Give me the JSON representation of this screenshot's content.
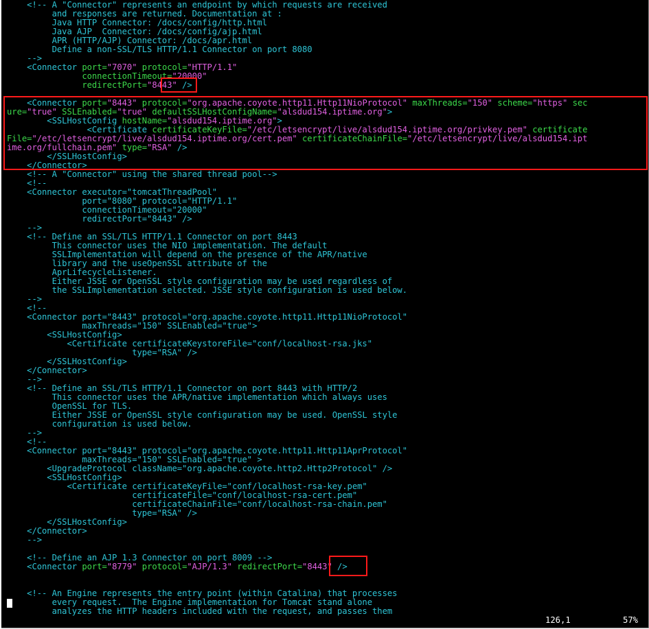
{
  "editor": {
    "lines": [
      [
        [
          "c",
          "    <!-- A \"Connector\" represents an endpoint by which requests are received"
        ]
      ],
      [
        [
          "c",
          "         and responses are returned. Documentation at :"
        ]
      ],
      [
        [
          "c",
          "         Java HTTP Connector: /docs/config/http.html"
        ]
      ],
      [
        [
          "c",
          "         Java AJP  Connector: /docs/config/ajp.html"
        ]
      ],
      [
        [
          "c",
          "         APR (HTTP/AJP) Connector: /docs/apr.html"
        ]
      ],
      [
        [
          "c",
          "         Define a non-SSL/TLS HTTP/1.1 Connector on port 8080"
        ]
      ],
      [
        [
          "c",
          "    -->"
        ]
      ],
      [
        [
          "c",
          "    <Connector "
        ],
        [
          "a",
          "port="
        ],
        [
          "v",
          "\"7070\" "
        ],
        [
          "a",
          "protocol="
        ],
        [
          "v",
          "\"HTTP/1.1\""
        ]
      ],
      [
        [
          "a",
          "               connectionTimeout="
        ],
        [
          "v",
          "\"20000\""
        ]
      ],
      [
        [
          "a",
          "               redirectPort="
        ],
        [
          "v",
          "\"8443\" "
        ],
        [
          "c",
          "/>"
        ]
      ],
      [
        [
          "t",
          ""
        ]
      ],
      [
        [
          "c",
          "    <Connector "
        ],
        [
          "a",
          "port="
        ],
        [
          "v",
          "\"8443\" "
        ],
        [
          "a",
          "protocol="
        ],
        [
          "v",
          "\"org.apache.coyote.http11.Http11NioProtocol\" "
        ],
        [
          "a",
          "maxThreads="
        ],
        [
          "v",
          "\"150\" "
        ],
        [
          "a",
          "scheme="
        ],
        [
          "v",
          "\"https\" "
        ],
        [
          "a",
          "sec"
        ]
      ],
      [
        [
          "a",
          "ure="
        ],
        [
          "v",
          "\"true\" "
        ],
        [
          "a",
          "SSLEnabled="
        ],
        [
          "v",
          "\"true\" "
        ],
        [
          "a",
          "defaultSSLHostConfigName="
        ],
        [
          "v",
          "\"alsdud154.iptime.org\""
        ],
        [
          "c",
          ">"
        ]
      ],
      [
        [
          "c",
          "        <SSLHostConfig "
        ],
        [
          "a",
          "hostName="
        ],
        [
          "v",
          "\"alsdud154.iptime.org\""
        ],
        [
          "c",
          ">"
        ]
      ],
      [
        [
          "c",
          "                <Certificate "
        ],
        [
          "a",
          "certificateKeyFile="
        ],
        [
          "v",
          "\"/etc/letsencrypt/live/alsdud154.iptime.org/privkey.pem\" "
        ],
        [
          "a",
          "certificate"
        ]
      ],
      [
        [
          "a",
          "File="
        ],
        [
          "v",
          "\"/etc/letsencrypt/live/alsdud154.iptime.org/cert.pem\" "
        ],
        [
          "a",
          "certificateChainFile="
        ],
        [
          "v",
          "\"/etc/letsencrypt/live/alsdud154.ipt"
        ]
      ],
      [
        [
          "v",
          "ime.org/fullchain.pem\" "
        ],
        [
          "a",
          "type="
        ],
        [
          "v",
          "\"RSA\" "
        ],
        [
          "c",
          "/>"
        ]
      ],
      [
        [
          "c",
          "        </SSLHostConfig>"
        ]
      ],
      [
        [
          "c",
          "    </Connector>"
        ]
      ],
      [
        [
          "c",
          "    <!-- A \"Connector\" using the shared thread pool-->"
        ]
      ],
      [
        [
          "c",
          "    <!--"
        ]
      ],
      [
        [
          "c",
          "    <Connector executor=\"tomcatThreadPool\""
        ]
      ],
      [
        [
          "c",
          "               port=\"8080\" protocol=\"HTTP/1.1\""
        ]
      ],
      [
        [
          "c",
          "               connectionTimeout=\"20000\""
        ]
      ],
      [
        [
          "c",
          "               redirectPort=\"8443\" />"
        ]
      ],
      [
        [
          "c",
          "    -->"
        ]
      ],
      [
        [
          "c",
          "    <!-- Define an SSL/TLS HTTP/1.1 Connector on port 8443"
        ]
      ],
      [
        [
          "c",
          "         This connector uses the NIO implementation. The default"
        ]
      ],
      [
        [
          "c",
          "         SSLImplementation will depend on the presence of the APR/native"
        ]
      ],
      [
        [
          "c",
          "         library and the useOpenSSL attribute of the"
        ]
      ],
      [
        [
          "c",
          "         AprLifecycleListener."
        ]
      ],
      [
        [
          "c",
          "         Either JSSE or OpenSSL style configuration may be used regardless of"
        ]
      ],
      [
        [
          "c",
          "         the SSLImplementation selected. JSSE style configuration is used below."
        ]
      ],
      [
        [
          "c",
          "    -->"
        ]
      ],
      [
        [
          "c",
          "    <!--"
        ]
      ],
      [
        [
          "c",
          "    <Connector port=\"8443\" protocol=\"org.apache.coyote.http11.Http11NioProtocol\""
        ]
      ],
      [
        [
          "c",
          "               maxThreads=\"150\" SSLEnabled=\"true\">"
        ]
      ],
      [
        [
          "c",
          "        <SSLHostConfig>"
        ]
      ],
      [
        [
          "c",
          "            <Certificate certificateKeystoreFile=\"conf/localhost-rsa.jks\""
        ]
      ],
      [
        [
          "c",
          "                         type=\"RSA\" />"
        ]
      ],
      [
        [
          "c",
          "        </SSLHostConfig>"
        ]
      ],
      [
        [
          "c",
          "    </Connector>"
        ]
      ],
      [
        [
          "c",
          "    -->"
        ]
      ],
      [
        [
          "c",
          "    <!-- Define an SSL/TLS HTTP/1.1 Connector on port 8443 with HTTP/2"
        ]
      ],
      [
        [
          "c",
          "         This connector uses the APR/native implementation which always uses"
        ]
      ],
      [
        [
          "c",
          "         OpenSSL for TLS."
        ]
      ],
      [
        [
          "c",
          "         Either JSSE or OpenSSL style configuration may be used. OpenSSL style"
        ]
      ],
      [
        [
          "c",
          "         configuration is used below."
        ]
      ],
      [
        [
          "c",
          "    -->"
        ]
      ],
      [
        [
          "c",
          "    <!--"
        ]
      ],
      [
        [
          "c",
          "    <Connector port=\"8443\" protocol=\"org.apache.coyote.http11.Http11AprProtocol\""
        ]
      ],
      [
        [
          "c",
          "               maxThreads=\"150\" SSLEnabled=\"true\" >"
        ]
      ],
      [
        [
          "c",
          "        <UpgradeProtocol className=\"org.apache.coyote.http2.Http2Protocol\" />"
        ]
      ],
      [
        [
          "c",
          "        <SSLHostConfig>"
        ]
      ],
      [
        [
          "c",
          "            <Certificate certificateKeyFile=\"conf/localhost-rsa-key.pem\""
        ]
      ],
      [
        [
          "c",
          "                         certificateFile=\"conf/localhost-rsa-cert.pem\""
        ]
      ],
      [
        [
          "c",
          "                         certificateChainFile=\"conf/localhost-rsa-chain.pem\""
        ]
      ],
      [
        [
          "c",
          "                         type=\"RSA\" />"
        ]
      ],
      [
        [
          "c",
          "        </SSLHostConfig>"
        ]
      ],
      [
        [
          "c",
          "    </Connector>"
        ]
      ],
      [
        [
          "c",
          "    -->"
        ]
      ],
      [
        [
          "t",
          ""
        ]
      ],
      [
        [
          "c",
          "    <!-- Define an AJP 1.3 Connector on port 8009 -->"
        ]
      ],
      [
        [
          "c",
          "    <Connector "
        ],
        [
          "a",
          "port="
        ],
        [
          "v",
          "\"8779\" "
        ],
        [
          "a",
          "protocol="
        ],
        [
          "v",
          "\"AJP/1.3\" "
        ],
        [
          "a",
          "redirectPort="
        ],
        [
          "v",
          "\"8443\" "
        ],
        [
          "c",
          "/>"
        ]
      ],
      [
        [
          "t",
          ""
        ]
      ],
      [
        [
          "t",
          ""
        ]
      ],
      [
        [
          "c",
          "    <!-- An Engine represents the entry point (within Catalina) that processes"
        ]
      ],
      [
        [
          "c",
          "         every request.  The Engine implementation for Tomcat stand alone"
        ]
      ],
      [
        [
          "c",
          "         analyzes the HTTP headers included with the request, and passes them"
        ]
      ]
    ]
  },
  "status": {
    "position": "126,1",
    "percent": "57%"
  },
  "colors": {
    "background": "#000000",
    "comment_tag": "#2ec5d6",
    "attribute": "#3cd84a",
    "value": "#e060e0",
    "highlight_box": "#ff1a1a"
  }
}
